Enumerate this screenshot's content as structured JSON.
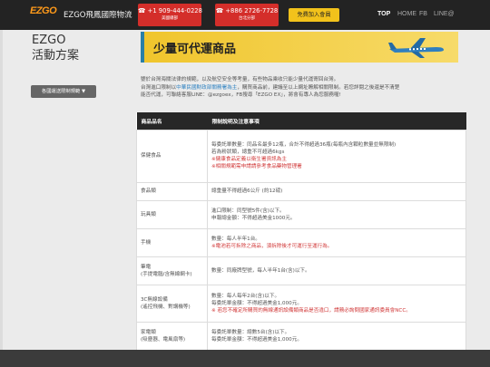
{
  "header": {
    "logo_text": "EZGO",
    "logo_subtext": "EZGO Express",
    "brand": "EZGO飛鳳國際物流",
    "phones": [
      {
        "number": "☎ +1 909-444-0228",
        "location": "美國總部"
      },
      {
        "number": "☎ +886 2726-7728",
        "location": "台北分部"
      }
    ],
    "join_label": "免費加入會員",
    "nav": [
      "TOP",
      "HOME",
      "FB",
      "LINE@"
    ]
  },
  "sidebar": {
    "title_line1": "EZGO",
    "title_line2": "活動方案",
    "rule_button": "各國運送限制規範 ▼"
  },
  "banner": {
    "title": "少量可代運商品"
  },
  "intro": {
    "line1": "鑒於台灣海關法律的規範，以及航空安全等考量，有些物品乘收只能少量代運寄回台灣。",
    "line2_pre": "台灣進口限制以",
    "line2_link": "中華民國財政部關務署為主",
    "line2_post": "，購買商品前，建議至以上網址瞭解相關限制。若您詳閱之後還是不清楚",
    "line3": "能否代運，可聯絡客服LINE：@ezgoex，FB搜尋「EZGO EX」，將會有專人為您服務喔!"
  },
  "table": {
    "headers": [
      "商品品名",
      "限制說明及注意事項"
    ],
    "rows": [
      {
        "name": "保健食品",
        "sub": "",
        "lines": [
          "每委託單數量：同品名最多12瓶，合計不得超過36瓶(每瓶內含顆粒數量並無限制)",
          "若為粉狀類，總重不可超過6kgs",
          "※健康食品定義以衛生署資訊為主",
          "※相關規範需申請請參考食品藥物管理署"
        ],
        "link_line": 3,
        "link_text": "食品藥物管理署"
      },
      {
        "name": "食品類",
        "sub": "",
        "lines": [
          "總重量不得超過6公斤 (約12磅)"
        ]
      },
      {
        "name": "玩具類",
        "sub": "",
        "lines": [
          "進口限制：同型號5件(含)以下。",
          "申報總金額：不得超過美金1000元。"
        ]
      },
      {
        "name": "手機",
        "sub": "",
        "lines": [
          "數量：每人半年1台。",
          "※電池若可拆除之商品，須拆除後才可運行至運行為。"
        ]
      },
      {
        "name": "筆電",
        "sub": "(手提電腦/含無線網卡)",
        "lines": [
          "數量：同廠牌型號，每人半年1台(含)以下。"
        ]
      },
      {
        "name": "3C無線設備",
        "sub": "(遙控飛機、對講機等)",
        "lines": [
          "數量：每人每年2台(含)以下。",
          "每委託單金額：不得超過美金1,000元。",
          "※ 若您不確定所購買的無線通訊設備類商品是否違口，請務必詢問國家通訊委員會NCC。"
        ]
      },
      {
        "name": "家電類",
        "sub": "(吸塵器、電風扇等)",
        "lines": [
          "每委託單數量：總數5台(含)以下。",
          "每委託單金額：不得超過美金1,000元。"
        ]
      }
    ]
  }
}
